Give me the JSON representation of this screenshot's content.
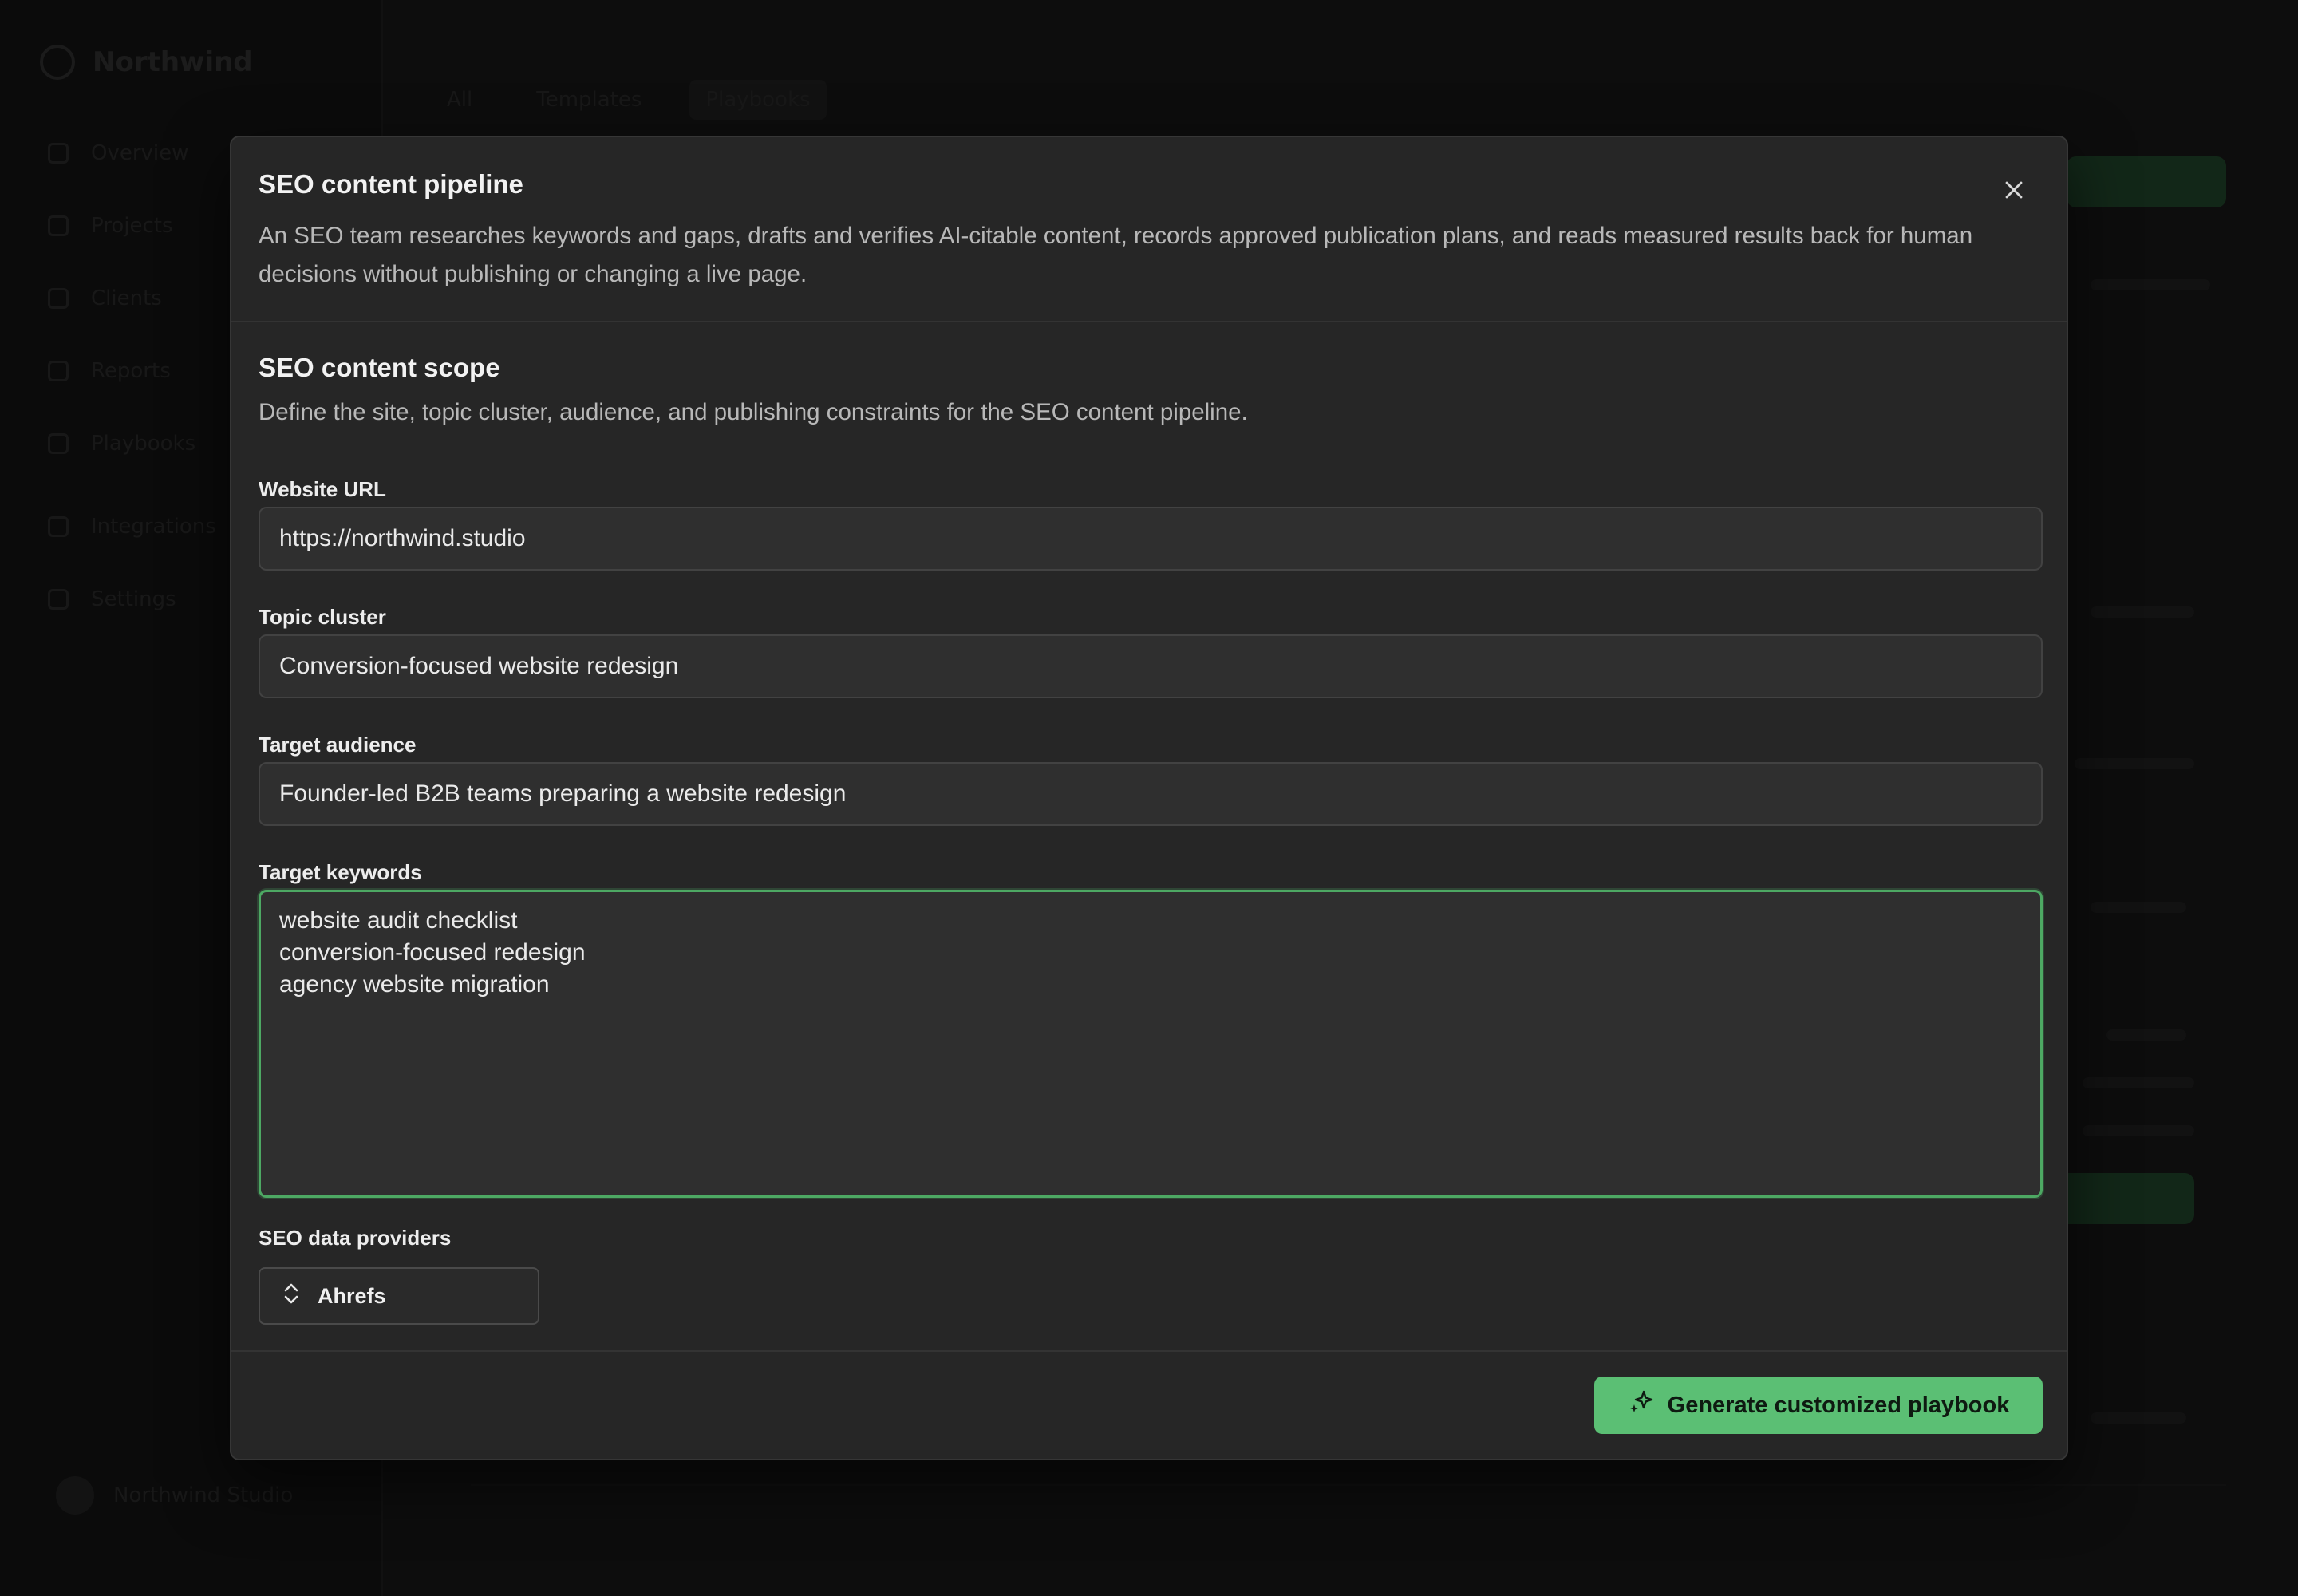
{
  "background_app": {
    "logo_text": "Northwind",
    "nav_items": [
      "Overview",
      "Projects",
      "Clients",
      "Reports",
      "Playbooks"
    ],
    "nav_secondary": [
      "Integrations",
      "Settings"
    ],
    "tabs": [
      "All",
      "Templates",
      "Playbooks"
    ],
    "user_name": "Northwind Studio"
  },
  "modal": {
    "title": "SEO content pipeline",
    "description": "An SEO team researches keywords and gaps, drafts and verifies AI-citable content, records approved publication plans, and reads measured results back for human decisions without publishing or changing a live page.",
    "close_icon": "close-icon"
  },
  "scope": {
    "title": "SEO content scope",
    "description": "Define the site, topic cluster, audience, and publishing constraints for the SEO content pipeline."
  },
  "fields": {
    "website_url": {
      "label": "Website URL",
      "value": "https://northwind.studio"
    },
    "topic_cluster": {
      "label": "Topic cluster",
      "value": "Conversion-focused website redesign"
    },
    "target_audience": {
      "label": "Target audience",
      "value": "Founder-led B2B teams preparing a website redesign"
    },
    "target_keywords": {
      "label": "Target keywords",
      "lines": [
        "website audit checklist",
        "conversion-focused redesign",
        "agency website migration"
      ]
    },
    "seo_providers": {
      "label": "SEO data providers",
      "selected": "Ahrefs",
      "icon": "chevron-up-down-icon"
    }
  },
  "footer": {
    "generate_label": "Generate customized playbook",
    "generate_icon": "sparkles-icon"
  },
  "colors": {
    "accent": "#5bbf74",
    "focus_border": "#4da863",
    "modal_bg": "#262626"
  }
}
